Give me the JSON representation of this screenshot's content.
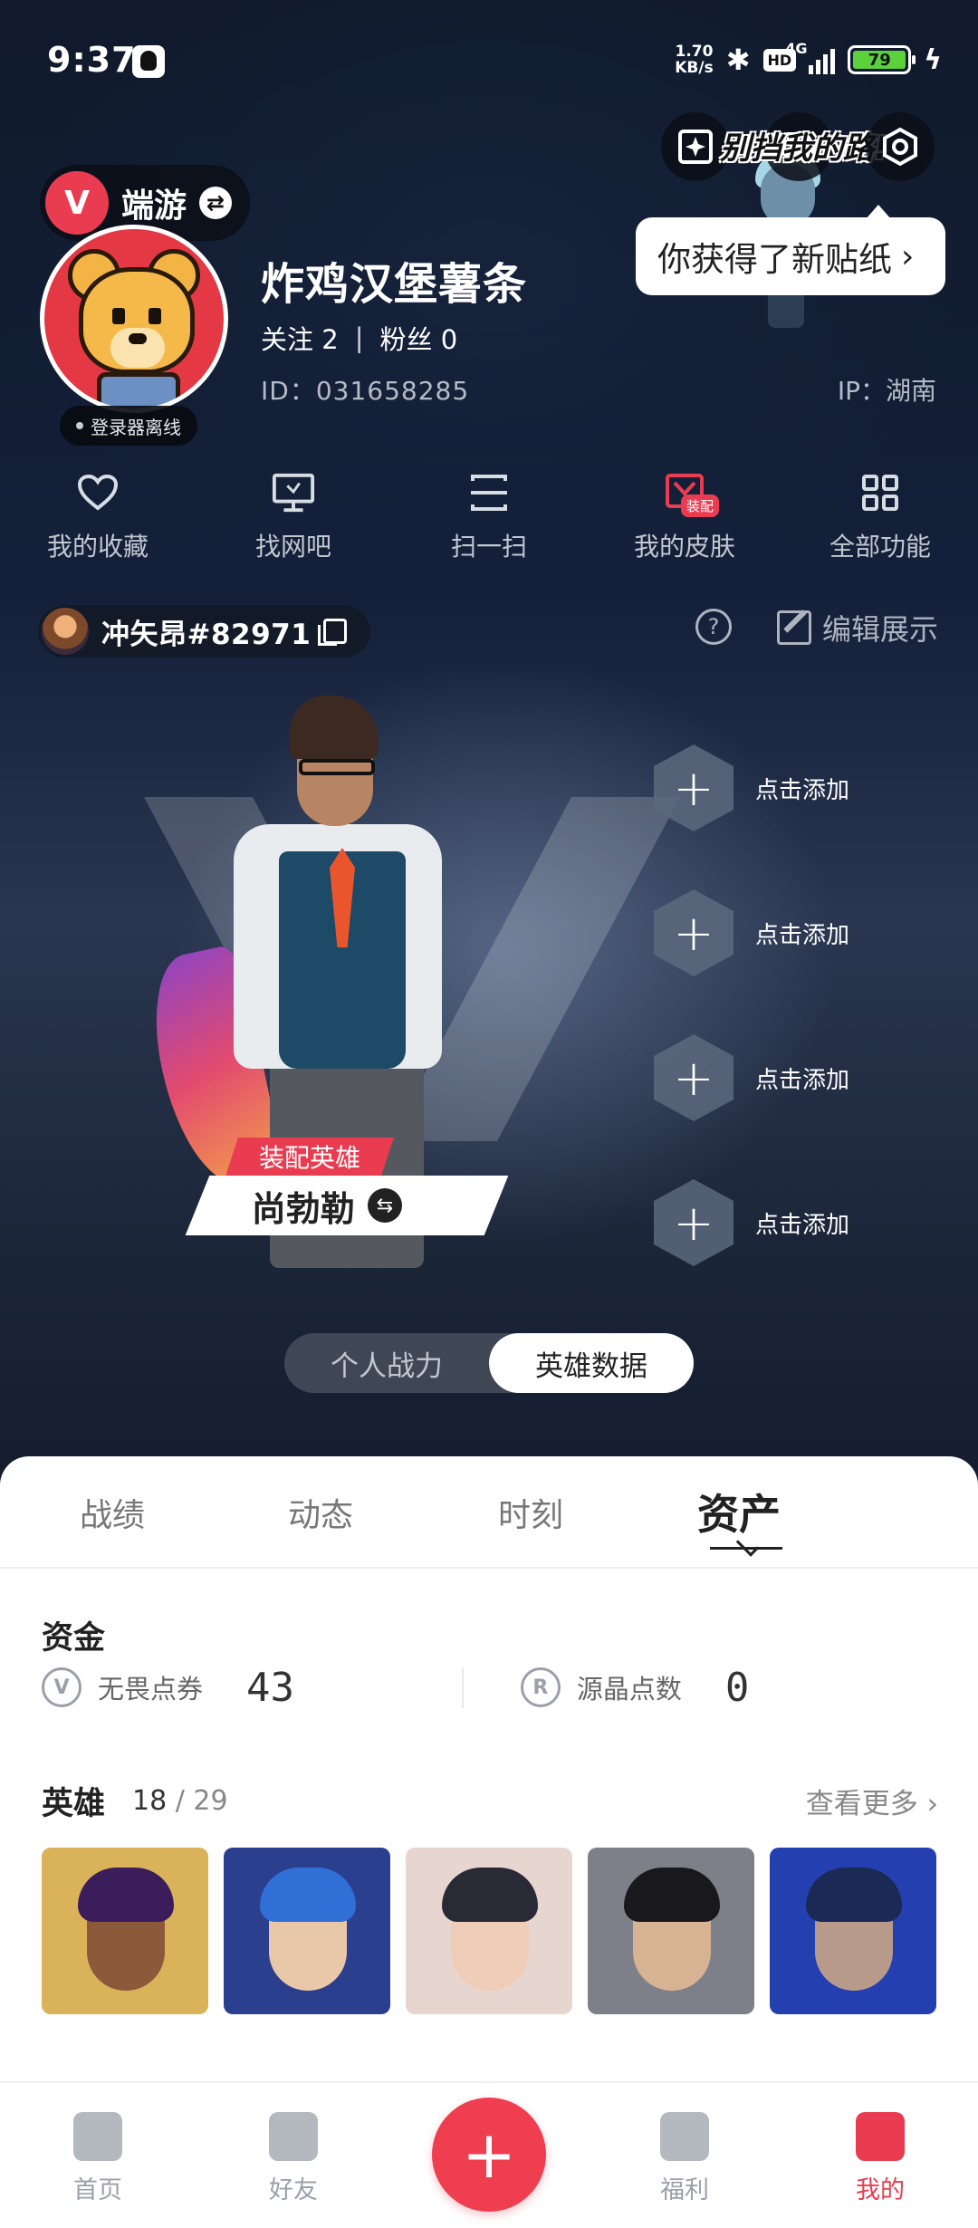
{
  "status_bar": {
    "time": "9:37",
    "net_speed_value": "1.70",
    "net_speed_unit": "KB/s",
    "hd": "HD",
    "signal": "4G",
    "battery_percent": "79"
  },
  "top": {
    "graffiti_text": "别挡我的路!",
    "sticker_notice": "你获得了新贴纸",
    "game_name": "端游"
  },
  "profile": {
    "username": "炸鸡汉堡薯条",
    "following_label": "关注",
    "following_count": "2",
    "followers_label": "粉丝",
    "followers_count": "0",
    "user_id": "ID：031658285",
    "ip_location": "IP：湖南",
    "login_status": "登录器离线"
  },
  "quick_actions": [
    {
      "label": "我的收藏",
      "icon": "heart-icon"
    },
    {
      "label": "找网吧",
      "icon": "monitor-icon"
    },
    {
      "label": "扫一扫",
      "icon": "scan-icon"
    },
    {
      "label": "我的皮肤",
      "icon": "skin-icon",
      "badge": "装配"
    },
    {
      "label": "全部功能",
      "icon": "grid-icon"
    }
  ],
  "riot": {
    "id_text": "冲矢昂#82971",
    "edit_label": "编辑展示"
  },
  "hero_display": {
    "equip_tag": "装配英雄",
    "hero_name": "尚勃勒",
    "add_slots": [
      "点击添加",
      "点击添加",
      "点击添加",
      "点击添加"
    ],
    "toggle": [
      "个人战力",
      "英雄数据"
    ],
    "toggle_active": 1
  },
  "tabs": [
    "战绩",
    "动态",
    "时刻",
    "资产"
  ],
  "assets": {
    "funds_title": "资金",
    "funds": [
      {
        "label": "无畏点券",
        "value": "43",
        "icon": "valorant-points-icon"
      },
      {
        "label": "源晶点数",
        "value": "0",
        "icon": "radianite-icon"
      }
    ],
    "heroes_title": "英雄",
    "heroes_owned": "18",
    "heroes_total": "29",
    "see_more": "查看更多"
  },
  "hero_card_colors": [
    {
      "bg": "#d9b25a",
      "hair": "#3a1d5a",
      "face": "#8c5a3a"
    },
    {
      "bg": "#2b3f8f",
      "hair": "#2f6fd6",
      "face": "#e9c7a9"
    },
    {
      "bg": "#e7d6cf",
      "hair": "#2a2a36",
      "face": "#f0cdb8"
    },
    {
      "bg": "#7d8088",
      "hair": "#18181d",
      "face": "#d7b394"
    },
    {
      "bg": "#2440b0",
      "hair": "#1a2a55",
      "face": "#b79a8a"
    }
  ],
  "bottom_nav": [
    {
      "label": "首页",
      "icon": "home-icon"
    },
    {
      "label": "好友",
      "icon": "friends-icon"
    },
    {
      "label": "",
      "icon": "plus-icon"
    },
    {
      "label": "福利",
      "icon": "gift-icon"
    },
    {
      "label": "我的",
      "icon": "profile-icon"
    }
  ],
  "colors": {
    "accent": "#ea3c50",
    "battery": "#5bd13c"
  }
}
